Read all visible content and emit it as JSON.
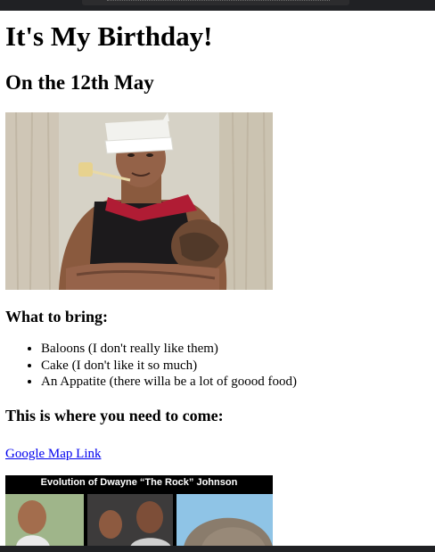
{
  "page": {
    "heading": "It's My Birthday!",
    "subheading": "On the 12th May",
    "bring_heading": "What to bring:",
    "bring_items": [
      "Baloons (I don't really like them)",
      "Cake (I don't like it so much)",
      "An Appatite (there willa be a lot of goood food)"
    ],
    "where_heading": "This is where you need to come:",
    "map_link": "Google Map Link",
    "evolution_banner": "Evolution of Dwayne “The Rock” Johnson"
  },
  "colors": {
    "link": "#0000ee",
    "chrome": "#202124"
  }
}
